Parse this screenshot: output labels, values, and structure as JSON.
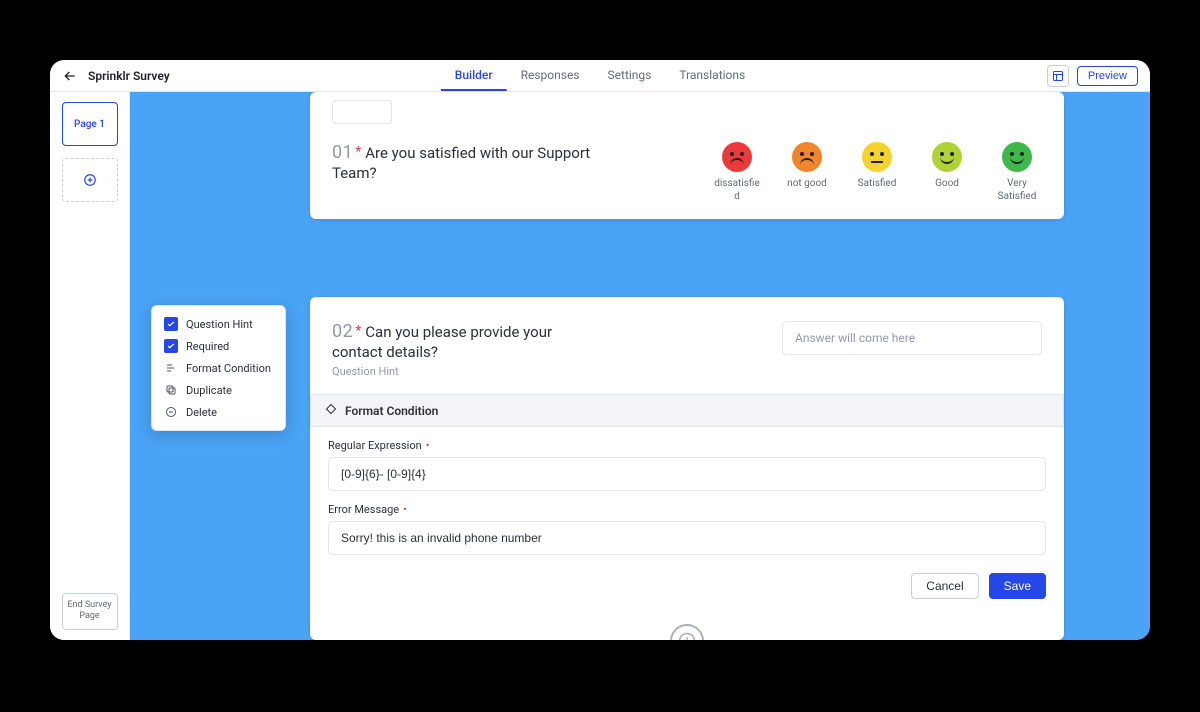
{
  "header": {
    "title": "Sprinklr Survey",
    "tabs": [
      "Builder",
      "Responses",
      "Settings",
      "Translations"
    ],
    "active_tab": "Builder",
    "preview_label": "Preview"
  },
  "sidebar": {
    "page_label": "Page 1",
    "end_label": "End Survey Page"
  },
  "context_menu": {
    "question_hint": "Question Hint",
    "required": "Required",
    "format_condition": "Format Condition",
    "duplicate": "Duplicate",
    "delete": "Delete"
  },
  "q1": {
    "number": "01",
    "text": "Are you satisfied with our Support Team?",
    "faces": [
      "dissatisfied",
      "not good",
      "Satisfied",
      "Good",
      "Very Satisfied"
    ]
  },
  "q2": {
    "number": "02",
    "text": "Can you please provide your contact details?",
    "hint": "Question Hint",
    "answer_placeholder": "Answer will come here"
  },
  "format_condition": {
    "title": "Format Condition",
    "regex_label": "Regular Expression",
    "regex_value": "[0-9]{6}- [0-9]{4}",
    "error_label": "Error Message",
    "error_value": "Sorry! this is an invalid phone number",
    "cancel": "Cancel",
    "save": "Save"
  }
}
